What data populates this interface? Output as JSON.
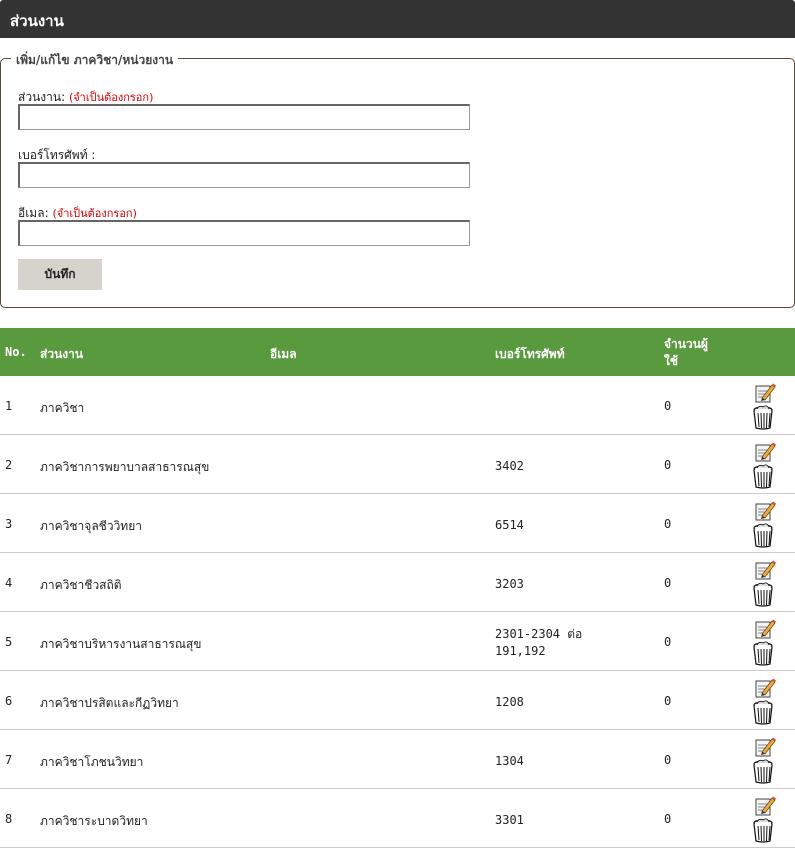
{
  "header": {
    "title": "ส่วนงาน"
  },
  "form": {
    "legend": "เพิ่ม/แก้ไข ภาควิชา/หน่วยงาน",
    "unit_label": "ส่วนงาน:",
    "unit_required": "(จำเป็นต้องกรอก)",
    "unit_value": "",
    "phone_label": "เบอร์โทรศัพท์ :",
    "phone_value": "",
    "email_label": "อีเมล:",
    "email_required": "(จำเป็นต้องกรอก)",
    "email_value": "",
    "save_label": "บันทึก"
  },
  "table": {
    "headers": {
      "no": "No.",
      "unit": "ส่วนงาน",
      "email": "อีเมล",
      "phone": "เบอร์โทรศัพท์",
      "count_line1": "จำนวนผู้",
      "count_line2": "ใช้"
    },
    "rows": [
      {
        "no": "1",
        "unit": "ภาควิชา",
        "email": "",
        "phone": "",
        "phone2": "",
        "count": "0"
      },
      {
        "no": "2",
        "unit": "ภาควิชาการพยาบาลสาธารณสุข",
        "email": "",
        "phone": "3402",
        "phone2": "",
        "count": "0"
      },
      {
        "no": "3",
        "unit": "ภาควิชาจุลชีววิทยา",
        "email": "",
        "phone": "6514",
        "phone2": "",
        "count": "0"
      },
      {
        "no": "4",
        "unit": "ภาควิชาชีวสถิติ",
        "email": "",
        "phone": "3203",
        "phone2": "",
        "count": "0"
      },
      {
        "no": "5",
        "unit": "ภาควิชาบริหารงานสาธารณสุข",
        "email": "",
        "phone": "2301-2304 ต่อ",
        "phone2": "191,192",
        "count": "0"
      },
      {
        "no": "6",
        "unit": "ภาควิชาปรสิตและกีฏวิทยา",
        "email": "",
        "phone": "1208",
        "phone2": "",
        "count": "0"
      },
      {
        "no": "7",
        "unit": "ภาควิชาโภชนวิทยา",
        "email": "",
        "phone": "1304",
        "phone2": "",
        "count": "0"
      },
      {
        "no": "8",
        "unit": "ภาควิชาระบาดวิทยา",
        "email": "",
        "phone": "3301",
        "phone2": "",
        "count": "0"
      }
    ]
  },
  "icons": {
    "edit": "edit-pencil-icon",
    "delete": "trash-bin-icon"
  },
  "colors": {
    "header_bar": "#333333",
    "table_header": "#5a9a3e",
    "required": "#dd0000",
    "button": "#d6d2cc"
  }
}
